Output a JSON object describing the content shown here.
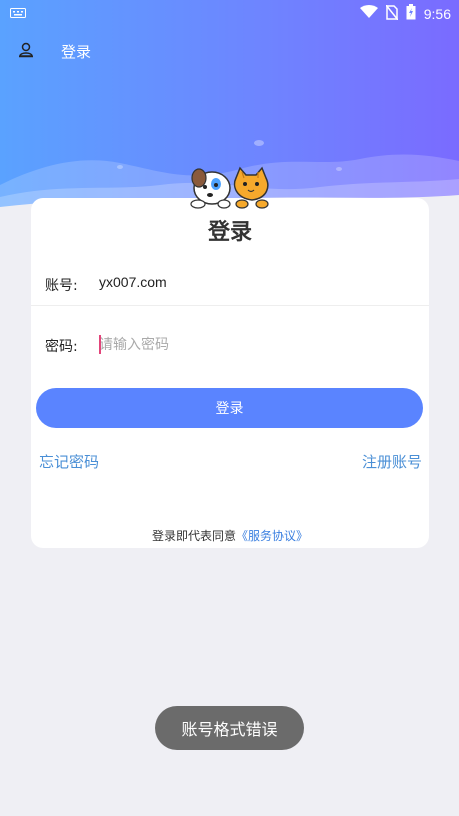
{
  "status_bar": {
    "time": "9:56",
    "icons": [
      "keyboard-icon",
      "wifi-icon",
      "no-sim-icon",
      "battery-charging-icon"
    ]
  },
  "navbar": {
    "icon": "user-icon",
    "title": "登录"
  },
  "card": {
    "title": "登录",
    "account": {
      "label": "账号:",
      "value": "yx007.com"
    },
    "password": {
      "label": "密码:",
      "placeholder": "请输入密码",
      "value": ""
    },
    "login_button": "登录",
    "forgot_password": "忘记密码",
    "register": "注册账号",
    "agreement_prefix": "登录即代表同意",
    "agreement_link": "《服务协议》"
  },
  "toast": "账号格式错误",
  "colors": {
    "header_start": "#5aa2ff",
    "header_end": "#7a6bff",
    "button": "#5a84ff",
    "link": "#4a8fd6",
    "background": "#efeff4"
  }
}
